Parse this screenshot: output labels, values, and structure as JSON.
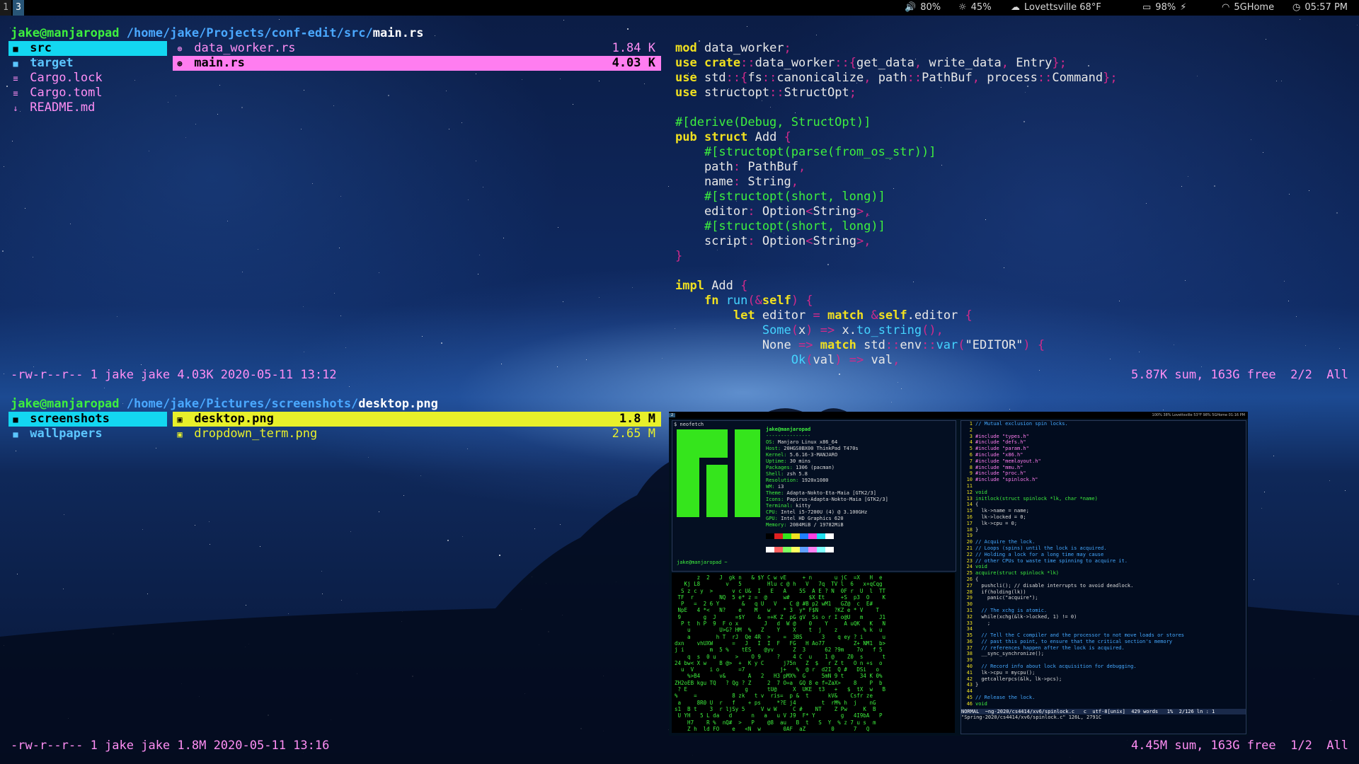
{
  "topbar": {
    "workspaces": [
      "1",
      "3"
    ],
    "active_workspace": "3",
    "volume": "80%",
    "brightness": "45%",
    "weather": "Lovettsville 68°F",
    "battery": "98%",
    "wifi": "5GHome",
    "clock": "05:57 PM"
  },
  "top_pane": {
    "prompt_user": "jake@manjaropad",
    "prompt_path": "/home/jake/Projects/conf-edit/src/",
    "prompt_file": "main.rs",
    "parent_items": [
      {
        "name": "src",
        "type": "dir",
        "selected": true
      },
      {
        "name": "target",
        "type": "dir"
      },
      {
        "name": "Cargo.lock",
        "type": "file"
      },
      {
        "name": "Cargo.toml",
        "type": "file"
      },
      {
        "name": "README.md",
        "type": "file"
      }
    ],
    "current_items": [
      {
        "name": "data_worker.rs",
        "size": "1.84 K"
      },
      {
        "name": "main.rs",
        "size": "4.03 K",
        "selected": true
      }
    ],
    "code_lines": [
      "mod data_worker;",
      "use crate::data_worker::{get_data, write_data, Entry};",
      "use std::{fs::canonicalize, path::PathBuf, process::Command};",
      "use structopt::StructOpt;",
      "",
      "#[derive(Debug, StructOpt)]",
      "pub struct Add {",
      "    #[structopt(parse(from_os_str))]",
      "    path: PathBuf,",
      "    name: String,",
      "    #[structopt(short, long)]",
      "    editor: Option<String>,",
      "    #[structopt(short, long)]",
      "    script: Option<String>,",
      "}",
      "",
      "impl Add {",
      "    fn run(&self) {",
      "        let editor = match &self.editor {",
      "            Some(x) => x.to_string(),",
      "            None => match std::env::var(\"EDITOR\") {",
      "                Ok(val) => val,"
    ],
    "status_left": "-rw-r--r-- 1 jake jake 4.03K 2020-05-11 13:12",
    "status_right": "5.87K sum, 163G free  2/2  All"
  },
  "bottom_pane": {
    "prompt_user": "jake@manjaropad",
    "prompt_path": "/home/jake/Pictures/screenshots/",
    "prompt_file": "desktop.png",
    "parent_items": [
      {
        "name": "screenshots",
        "type": "dir",
        "selected": true
      },
      {
        "name": "wallpapers",
        "type": "dir"
      }
    ],
    "current_items": [
      {
        "name": "desktop.png",
        "size": "1.8 M",
        "selected": true
      },
      {
        "name": "dropdown_term.png",
        "size": "2.65 M"
      }
    ],
    "status_left": "-rw-r--r-- 1 jake jake 1.8M 2020-05-11 13:16",
    "status_right": "4.45M sum, 163G free  1/2  All"
  },
  "preview": {
    "bar_left": "2",
    "bar_right": "100%  38%  Lovettsville 53°F  98%  5GHome  01:16 PM",
    "neofetch_cmd": "$ neofetch",
    "neofetch_user": "jake@manjaropad",
    "neofetch_info": [
      "OS: Manjaro Linux x86_64",
      "Host: 20HGS0BX00 ThinkPad T470s",
      "Kernel: 5.6.16-3-MANJARO",
      "Uptime: 30 mins",
      "Packages: 1306 (pacman)",
      "Shell: zsh 5.8",
      "Resolution: 1920x1080",
      "WM: i3",
      "Theme: Adapta-Nokto-Eta-Maia [GTK2/3]",
      "Icons: Papirus-Adapta-Nokto-Maia [GTK2/3]",
      "Terminal: kitty",
      "CPU: Intel i5-7200U (4) @ 3.100GHz",
      "GPU: Intel HD Graphics 620",
      "Memory: 2084MiB / 19782MiB"
    ],
    "neofetch_prompt": "jake@manjaropad ~",
    "vim_lines": [
      "// Mutual exclusion spin locks.",
      "",
      "#include \"types.h\"",
      "#include \"defs.h\"",
      "#include \"param.h\"",
      "#include \"x86.h\"",
      "#include \"memlayout.h\"",
      "#include \"mmu.h\"",
      "#include \"proc.h\"",
      "#include \"spinlock.h\"",
      "",
      "void",
      "initlock(struct spinlock *lk, char *name)",
      "{",
      "  lk->name = name;",
      "  lk->locked = 0;",
      "  lk->cpu = 0;",
      "}",
      "",
      "// Acquire the lock.",
      "// Loops (spins) until the lock is acquired.",
      "// Holding a lock for a long time may cause",
      "// other CPUs to waste time spinning to acquire it.",
      "void",
      "acquire(struct spinlock *lk)",
      "{",
      "  pushcli(); // disable interrupts to avoid deadlock.",
      "  if(holding(lk))",
      "    panic(\"acquire\");",
      "",
      "  // The xchg is atomic.",
      "  while(xchg(&lk->locked, 1) != 0)",
      "    ;",
      "",
      "  // Tell the C compiler and the processor to not move loads or stores",
      "  // past this point, to ensure that the critical section's memory",
      "  // references happen after the lock is acquired.",
      "  __sync_synchronize();",
      "",
      "  // Record info about lock acquisition for debugging.",
      "  lk->cpu = mycpu();",
      "  getcallerpcs(&lk, lk->pcs);",
      "}",
      "",
      "// Release the lock.",
      "void"
    ],
    "vim_status": "NORMAL  ~ng-2020/cs4414/xv6/spinlock.c   c  utf-8[unix]  429 words   1%  2/126 ln : 1",
    "vim_cmdline": "\"Spring-2020/cs4414/xv6/spinlock.c\" 126L, 2791C"
  },
  "colors": {
    "selection_cyan": "#13d7f1",
    "selection_pink": "#ff7df0",
    "selection_yellow": "#e8f02a",
    "prompt_green": "#3ef03e",
    "path_blue": "#4aa8ff"
  },
  "icons": {
    "dir": "folder-icon",
    "file": "text-file-icon",
    "readme": "markdown-icon",
    "rs": "rust-file-icon",
    "image": "image-file-icon"
  }
}
